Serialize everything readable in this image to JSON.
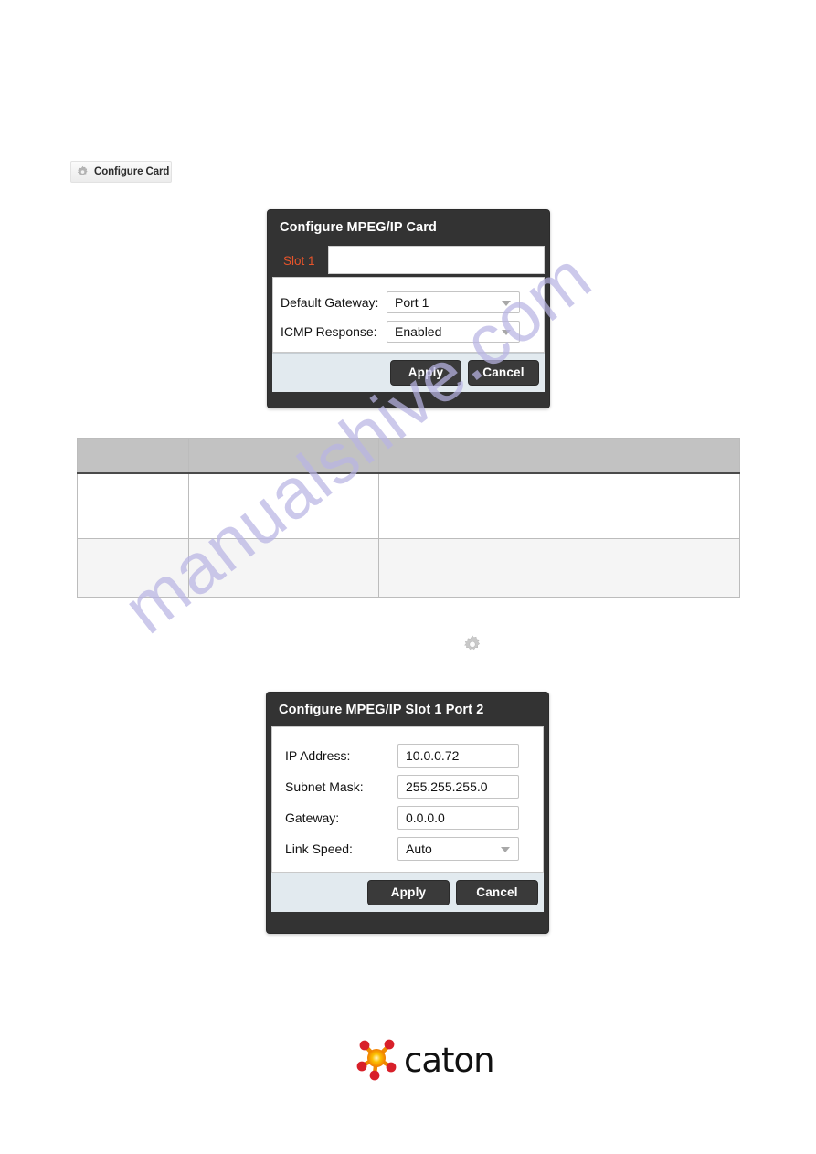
{
  "toolbar": {
    "configure_card_label": "Configure Card",
    "gear_icon": "gear-icon"
  },
  "watermark": {
    "text": "manualshive.com",
    "color": "#b9b5e4"
  },
  "dialog_card": {
    "title": "Configure MPEG/IP Card",
    "tab_label": "Slot 1",
    "tab_color": "#e8542a",
    "header_bg": "#333333",
    "footer_bg": "#e2eaef",
    "fields": [
      {
        "label": "Default Gateway:",
        "value": "Port 1",
        "type": "select"
      },
      {
        "label": "ICMP Response:",
        "value": "Enabled",
        "type": "select"
      }
    ],
    "apply_label": "Apply",
    "cancel_label": "Cancel"
  },
  "gear_standalone": {
    "icon": "gear-icon"
  },
  "spec_table": {
    "headers": [
      "",
      "",
      ""
    ],
    "rows": [
      [
        "",
        "",
        ""
      ],
      [
        "",
        "",
        ""
      ]
    ]
  },
  "dialog_port": {
    "title": "Configure MPEG/IP Slot 1 Port 2",
    "header_bg": "#333333",
    "footer_bg": "#e2eaef",
    "fields": [
      {
        "label": "IP Address:",
        "value": "10.0.0.72",
        "type": "text"
      },
      {
        "label": "Subnet Mask:",
        "value": "255.255.255.0",
        "type": "text"
      },
      {
        "label": "Gateway:",
        "value": "0.0.0.0",
        "type": "text"
      },
      {
        "label": "Link Speed:",
        "value": "Auto",
        "type": "select"
      }
    ],
    "apply_label": "Apply",
    "cancel_label": "Cancel"
  },
  "brand": {
    "name": "caton",
    "logo_icon": "caton-molecule-icon",
    "accent_red": "#d8202a",
    "accent_orange": "#f6a000"
  }
}
